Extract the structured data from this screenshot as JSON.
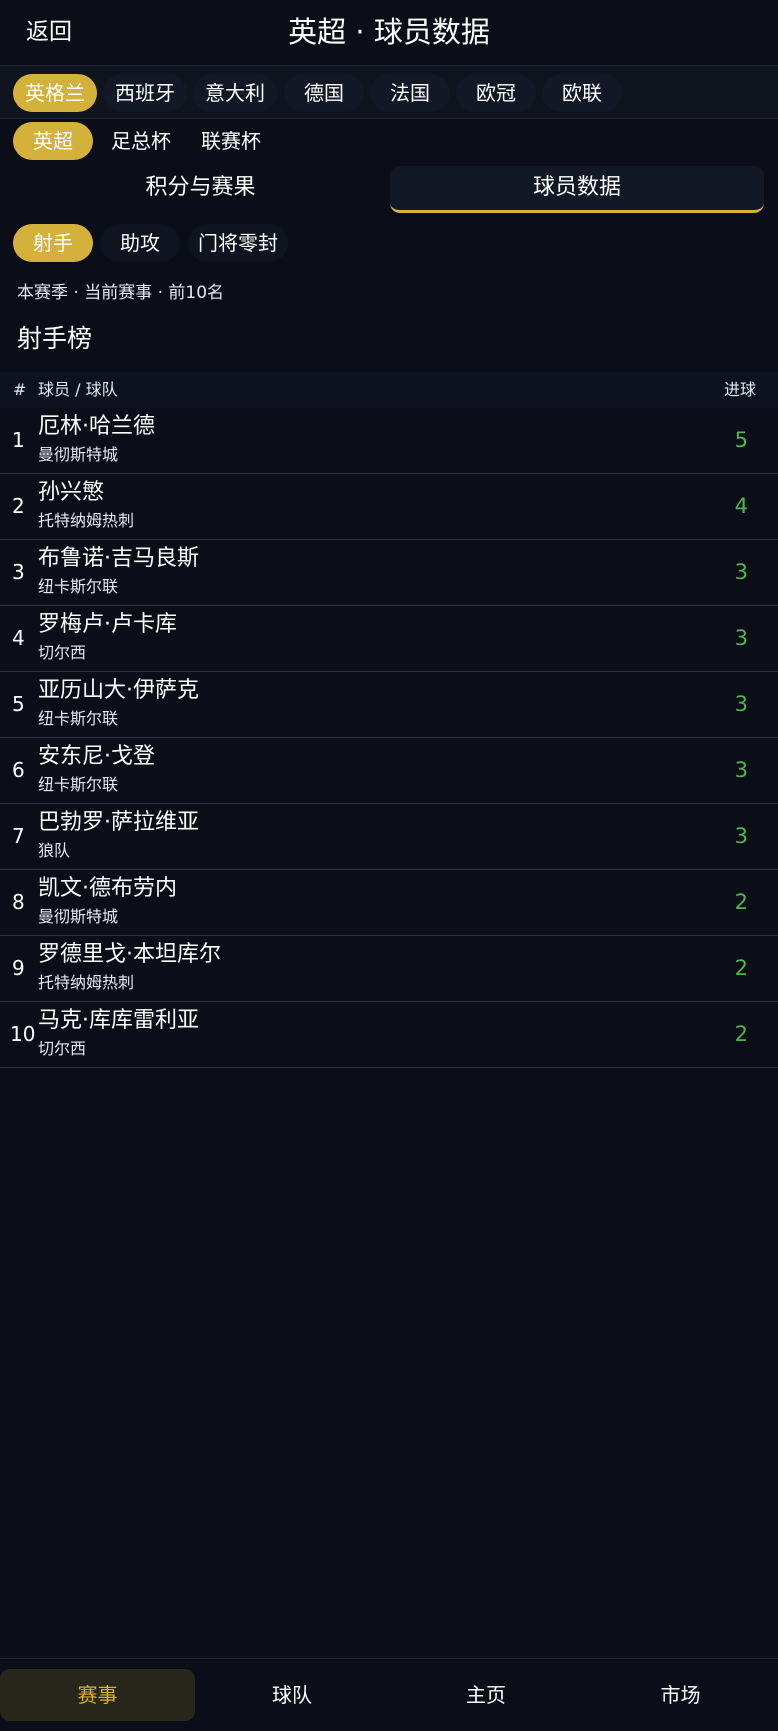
{
  "header": {
    "back_label": "返回",
    "title": "英超 · 球员数据"
  },
  "countries": [
    {
      "label": "英格兰",
      "active": true
    },
    {
      "label": "西班牙",
      "active": false
    },
    {
      "label": "意大利",
      "active": false
    },
    {
      "label": "德国",
      "active": false
    },
    {
      "label": "法国",
      "active": false
    },
    {
      "label": "欧冠",
      "active": false
    },
    {
      "label": "欧联",
      "active": false
    }
  ],
  "competitions": [
    {
      "label": "英超",
      "active": true
    },
    {
      "label": "足总杯",
      "active": false
    },
    {
      "label": "联赛杯",
      "active": false
    }
  ],
  "segments": [
    {
      "label": "积分与赛果",
      "active": false
    },
    {
      "label": "球员数据",
      "active": true
    }
  ],
  "stat_tabs": [
    {
      "label": "射手",
      "active": true
    },
    {
      "label": "助攻",
      "active": false
    },
    {
      "label": "门将零封",
      "active": false
    }
  ],
  "meta": "本赛季 · 当前赛事 · 前10名",
  "section_title": "射手榜",
  "table": {
    "headers": {
      "rank": "#",
      "player": "球员 / 球队",
      "goals": "进球"
    },
    "rows": [
      {
        "rank": "1",
        "player": "厄林·哈兰德",
        "team": "曼彻斯特城",
        "goals": "5"
      },
      {
        "rank": "2",
        "player": "孙兴慜",
        "team": "托特纳姆热刺",
        "goals": "4"
      },
      {
        "rank": "3",
        "player": "布鲁诺·吉马良斯",
        "team": "纽卡斯尔联",
        "goals": "3"
      },
      {
        "rank": "4",
        "player": "罗梅卢·卢卡库",
        "team": "切尔西",
        "goals": "3"
      },
      {
        "rank": "5",
        "player": "亚历山大·伊萨克",
        "team": "纽卡斯尔联",
        "goals": "3"
      },
      {
        "rank": "6",
        "player": "安东尼·戈登",
        "team": "纽卡斯尔联",
        "goals": "3"
      },
      {
        "rank": "7",
        "player": "巴勃罗·萨拉维亚",
        "team": "狼队",
        "goals": "3"
      },
      {
        "rank": "8",
        "player": "凯文·德布劳内",
        "team": "曼彻斯特城",
        "goals": "2"
      },
      {
        "rank": "9",
        "player": "罗德里戈·本坦库尔",
        "team": "托特纳姆热刺",
        "goals": "2"
      },
      {
        "rank": "10",
        "player": "马克·库库雷利亚",
        "team": "切尔西",
        "goals": "2"
      }
    ]
  },
  "bottom_nav": [
    {
      "label": "赛事",
      "active": true
    },
    {
      "label": "球队",
      "active": false
    },
    {
      "label": "主页",
      "active": false
    },
    {
      "label": "市场",
      "active": false
    }
  ],
  "colors": {
    "accent": "#d4b13a",
    "background": "#0b0e18",
    "goal_green": "#4cb84c"
  }
}
